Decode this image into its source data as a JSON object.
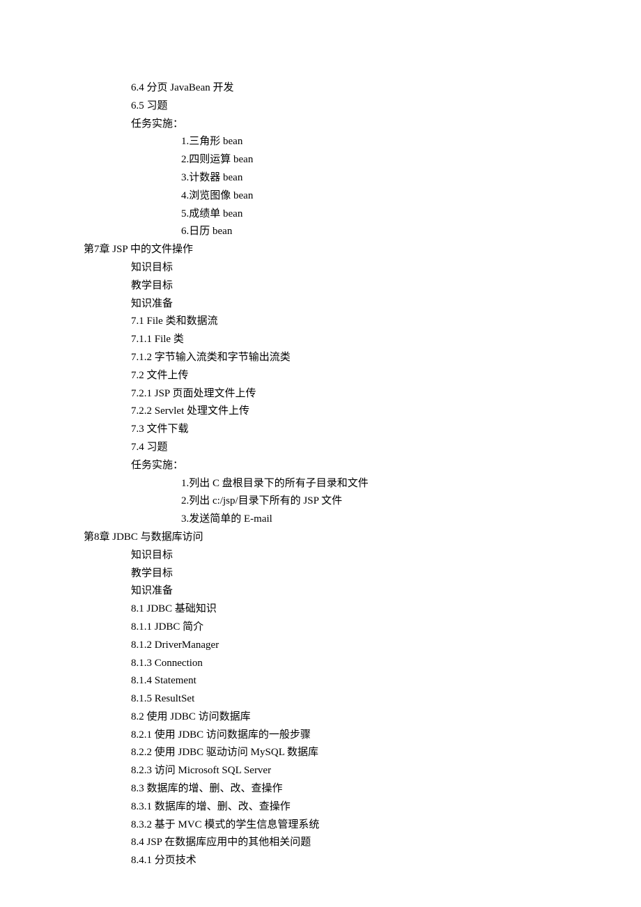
{
  "lines": [
    {
      "indent": "sub",
      "text": "6.4 分页 JavaBean 开发"
    },
    {
      "indent": "sub",
      "text": "6.5 习题"
    },
    {
      "indent": "sub",
      "text": "任务实施："
    },
    {
      "indent": "task",
      "text": "1.三角形 bean"
    },
    {
      "indent": "task",
      "text": "2.四则运算 bean"
    },
    {
      "indent": "task",
      "text": "3.计数器 bean"
    },
    {
      "indent": "task",
      "text": "4.浏览图像 bean"
    },
    {
      "indent": "task",
      "text": "5.成绩单 bean"
    },
    {
      "indent": "task",
      "text": "6.日历 bean"
    },
    {
      "indent": "chapter",
      "text": "第7章 JSP 中的文件操作"
    },
    {
      "indent": "sub",
      "text": "知识目标"
    },
    {
      "indent": "sub",
      "text": "教学目标"
    },
    {
      "indent": "sub",
      "text": "知识准备"
    },
    {
      "indent": "sub",
      "text": "7.1 File 类和数据流"
    },
    {
      "indent": "sub",
      "text": "7.1.1 File 类"
    },
    {
      "indent": "sub",
      "text": "7.1.2 字节输入流类和字节输出流类"
    },
    {
      "indent": "sub",
      "text": "7.2 文件上传"
    },
    {
      "indent": "sub",
      "text": "7.2.1 JSP 页面处理文件上传"
    },
    {
      "indent": "sub",
      "text": "7.2.2 Servlet 处理文件上传"
    },
    {
      "indent": "sub",
      "text": "7.3 文件下载"
    },
    {
      "indent": "sub",
      "text": "7.4 习题"
    },
    {
      "indent": "sub",
      "text": "任务实施："
    },
    {
      "indent": "task",
      "text": "1.列出 C 盘根目录下的所有子目录和文件"
    },
    {
      "indent": "task",
      "text": "2.列出 c:/jsp/目录下所有的 JSP 文件"
    },
    {
      "indent": "task",
      "text": "3.发送简单的 E-mail"
    },
    {
      "indent": "chapter",
      "text": "第8章 JDBC 与数据库访问"
    },
    {
      "indent": "sub",
      "text": "知识目标"
    },
    {
      "indent": "sub",
      "text": "教学目标"
    },
    {
      "indent": "sub",
      "text": "知识准备"
    },
    {
      "indent": "sub",
      "text": "8.1 JDBC 基础知识"
    },
    {
      "indent": "sub",
      "text": "8.1.1 JDBC 简介"
    },
    {
      "indent": "sub",
      "text": "8.1.2 DriverManager"
    },
    {
      "indent": "sub",
      "text": "8.1.3 Connection"
    },
    {
      "indent": "sub",
      "text": "8.1.4 Statement"
    },
    {
      "indent": "sub",
      "text": "8.1.5 ResultSet"
    },
    {
      "indent": "sub",
      "text": "8.2 使用 JDBC 访问数据库"
    },
    {
      "indent": "sub",
      "text": "8.2.1 使用 JDBC 访问数据库的一般步骤"
    },
    {
      "indent": "sub",
      "text": "8.2.2 使用 JDBC 驱动访问 MySQL 数据库"
    },
    {
      "indent": "sub",
      "text": "8.2.3 访问 Microsoft SQL Server"
    },
    {
      "indent": "sub",
      "text": "8.3 数据库的增、删、改、查操作"
    },
    {
      "indent": "sub",
      "text": "8.3.1 数据库的增、删、改、查操作"
    },
    {
      "indent": "sub",
      "text": "8.3.2 基于 MVC 模式的学生信息管理系统"
    },
    {
      "indent": "sub",
      "text": "8.4 JSP 在数据库应用中的其他相关问题"
    },
    {
      "indent": "sub",
      "text": "8.4.1 分页技术"
    }
  ]
}
